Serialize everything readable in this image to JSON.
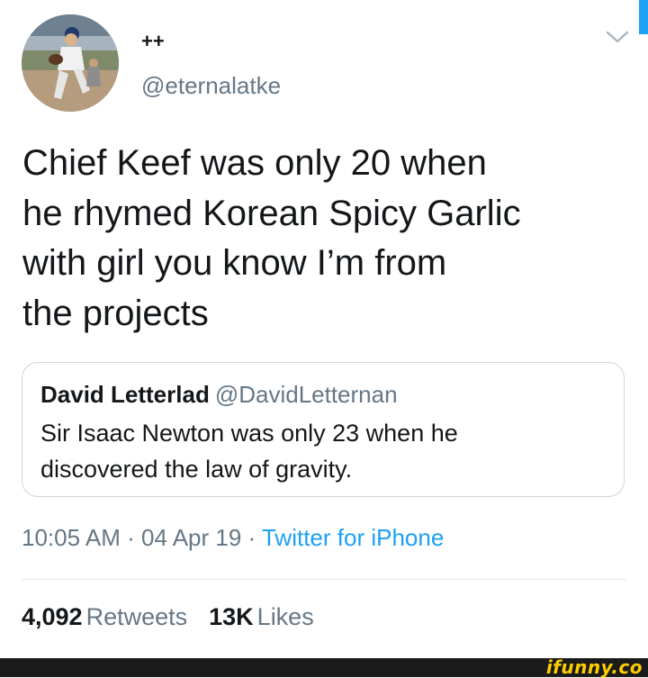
{
  "tweet": {
    "display_name": "++",
    "handle": "@eternalatke",
    "text_lines": [
      "Chief Keef was only 20 when",
      "he rhymed Korean Spicy Garlic",
      "with girl you know I’m from",
      "the projects"
    ],
    "menu_icon": "chevron-down-icon",
    "avatar_icon": "baseball-player-photo"
  },
  "quote": {
    "name": "David Letterlad",
    "handle": "@DavidLetternan",
    "text_lines": [
      "Sir Isaac Newton was only 23 when he",
      "discovered the law of gravity."
    ]
  },
  "meta": {
    "time": "10:05 AM",
    "date": "04 Apr 19",
    "separator": "·",
    "source": "Twitter for iPhone"
  },
  "stats": {
    "retweets_count": "4,092",
    "retweets_label": "Retweets",
    "likes_count": "13K",
    "likes_label": "Likes"
  },
  "watermark": {
    "text": "ifunny.co"
  },
  "colors": {
    "text": "#14171a",
    "secondary": "#657786",
    "link": "#1da1f2",
    "border": "#ccd6dd",
    "watermark": "#ffcc00"
  }
}
